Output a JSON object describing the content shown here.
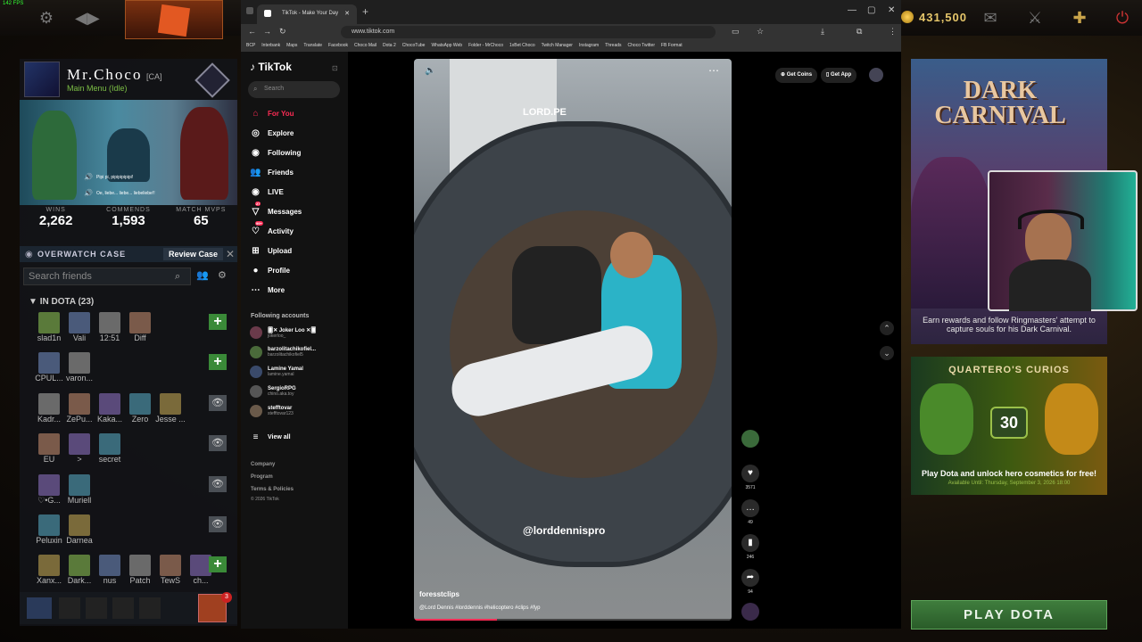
{
  "topbar": {
    "fps": "142 FPS",
    "gold": "431,500"
  },
  "profile": {
    "name": "Mr.Choco",
    "tag": "[CA]",
    "status": "Main Menu (Idle)",
    "overlay_text_1": "Pipi pi, pipipipipipi!",
    "overlay_text_2": "Oe, liebe... liebe... liebeliebe!!"
  },
  "stats": [
    {
      "label": "WINS",
      "value": "2,262"
    },
    {
      "label": "COMMENDS",
      "value": "1,593"
    },
    {
      "label": "MATCH MVPS",
      "value": "65"
    }
  ],
  "overwatch": {
    "label": "OVERWATCH CASE",
    "button": "Review Case"
  },
  "friends_search": {
    "placeholder": "Search friends"
  },
  "in_dota": {
    "header": "IN DOTA (23)"
  },
  "friends": [
    [
      "slad1n",
      "Vali",
      "12:51",
      "Diff"
    ],
    [
      "CPUL...",
      "varon..."
    ],
    [
      "Kadr...",
      "ZePu...",
      "Kaka...",
      "Zero",
      "Jesse ..."
    ],
    [
      "EU",
      ">",
      "secret"
    ],
    [
      "♡•G...",
      "Muriell"
    ],
    [
      "Peluxin",
      "Darnea"
    ],
    [
      "Xanx...",
      "Dark...",
      "nus",
      "Patch",
      "TewS",
      "ch..."
    ]
  ],
  "party": {
    "badge": "3"
  },
  "browser": {
    "tab_title": "TikTok - Make Your Day",
    "url": "www.tiktok.com",
    "bookmarks": [
      "BCP",
      "Interbank",
      "Maps",
      "Translate",
      "Facebook",
      "Choco Mail",
      "Dota 2",
      "ChocoTube",
      "WhatsApp Web",
      "Folder - MrChoco",
      "1xBet Choco",
      "Twitch Manager",
      "Instagram",
      "Threads",
      "Choco Twitter",
      "FB Format"
    ]
  },
  "tiktok": {
    "logo": "TikTok",
    "search_placeholder": "Search",
    "nav": [
      {
        "label": "For You",
        "icon": "home-icon"
      },
      {
        "label": "Explore",
        "icon": "compass-icon"
      },
      {
        "label": "Following",
        "icon": "following-icon"
      },
      {
        "label": "Friends",
        "icon": "friends-icon"
      },
      {
        "label": "LIVE",
        "icon": "live-icon"
      },
      {
        "label": "Messages",
        "icon": "messages-icon",
        "badge": "27"
      },
      {
        "label": "Activity",
        "icon": "activity-icon",
        "badge": "99+"
      },
      {
        "label": "Upload",
        "icon": "upload-icon"
      },
      {
        "label": "Profile",
        "icon": "profile-icon"
      },
      {
        "label": "More",
        "icon": "more-icon"
      }
    ],
    "following_header": "Following accounts",
    "following": [
      {
        "name": "🂠✕ Joker Loo ✕🂠",
        "handle": "jokerloo_"
      },
      {
        "name": "barzolitachikofiel...",
        "handle": "barzolitachikofiel5"
      },
      {
        "name": "Lamine Yamal",
        "handle": "lamine.yamal"
      },
      {
        "name": "SergioRPG",
        "handle": "chino.aka.toy"
      },
      {
        "name": "stefftovar",
        "handle": "stefftovar123"
      }
    ],
    "view_all": "View all",
    "footer": [
      "Company",
      "Program",
      "Terms & Policies",
      "© 2026 TikTok"
    ],
    "top_buttons": [
      "Get Coins",
      "Get App"
    ],
    "video": {
      "watermark_top": "LORD.PE",
      "watermark_handle": "@lorddennispro",
      "author": "foresstclips",
      "description": "@Lord Dennis #lorddennis #helicoptero #clips #fyp",
      "progress": 0.26
    },
    "actions": [
      {
        "icon": "heart-icon",
        "count": "3571"
      },
      {
        "icon": "comment-icon",
        "count": "49"
      },
      {
        "icon": "bookmark-icon",
        "count": "246"
      },
      {
        "icon": "share-icon",
        "count": "94"
      }
    ]
  },
  "ads": {
    "event_title_1": "DARK",
    "event_title_2": "CARNIVAL",
    "event_text": "Earn rewards and follow Ringmasters' attempt to capture souls for his Dark Carnival.",
    "curios_title": "QUARTERO'S CURIOS",
    "curios_badge": "30",
    "curios_text": "Play Dota and unlock hero cosmetics for free!",
    "curios_sub": "Available Until:  Thursday, September 3, 2026 18:00"
  },
  "play_button": "PLAY DOTA"
}
